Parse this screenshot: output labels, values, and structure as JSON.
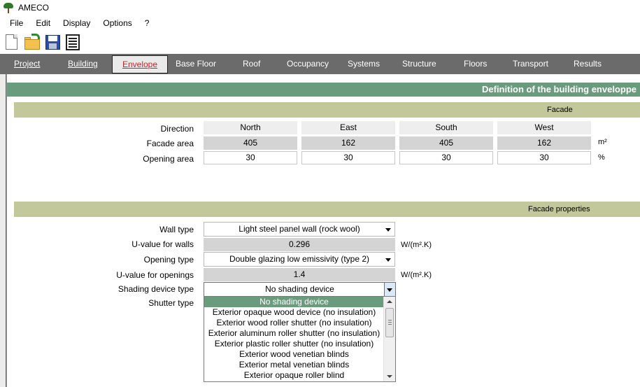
{
  "window": {
    "title": "AMECO"
  },
  "menu": [
    "File",
    "Edit",
    "Display",
    "Options",
    "?"
  ],
  "toolbar": {
    "icons": [
      "new-file-icon",
      "open-folder-icon",
      "save-disk-icon",
      "report-icon"
    ]
  },
  "tabs": [
    {
      "label": "Project"
    },
    {
      "label": "Building"
    },
    {
      "label": "Envelope"
    },
    {
      "label": "Base Floor"
    },
    {
      "label": "Roof"
    },
    {
      "label": "Occupancy"
    },
    {
      "label": "Systems"
    },
    {
      "label": "Structure"
    },
    {
      "label": "Floors"
    },
    {
      "label": "Transport"
    },
    {
      "label": "Results"
    }
  ],
  "page": {
    "header": "Definition of the building enveloppe"
  },
  "facade": {
    "section_title": "Facade",
    "direction_label": "Direction",
    "area_label": "Facade area",
    "opening_label": "Opening area",
    "area_unit": "m²",
    "opening_unit": "%",
    "columns": [
      {
        "direction": "North",
        "area": "405",
        "opening": "30"
      },
      {
        "direction": "East",
        "area": "162",
        "opening": "30"
      },
      {
        "direction": "South",
        "area": "405",
        "opening": "30"
      },
      {
        "direction": "West",
        "area": "162",
        "opening": "30"
      }
    ]
  },
  "properties": {
    "section_title": "Facade properties",
    "wall_type_label": "Wall type",
    "wall_type_value": "Light steel panel wall (rock wool)",
    "u_walls_label": "U-value for walls",
    "u_walls_value": "0.296",
    "u_unit": "W/(m².K)",
    "opening_type_label": "Opening type",
    "opening_type_value": "Double glazing low emissivity (type 2)",
    "u_openings_label": "U-value for openings",
    "u_openings_value": "1.4",
    "shading_label": "Shading device type",
    "shading_value": "No shading device",
    "shutter_label": "Shutter type"
  },
  "shading_options": [
    "No shading device",
    "Exterior opaque wood device (no insulation)",
    "Exterior wood roller shutter (no insulation)",
    "Exterior aluminum roller shutter (no insulation)",
    "Exterior plastic roller shutter (no insulation)",
    "Exterior wood venetian blinds",
    "Exterior metal venetian blinds",
    "Exterior opaque roller blind"
  ],
  "colors": {
    "nav_bg": "#6b6b6b",
    "header_green": "#6b9b7d",
    "section_olive": "#c2c89a",
    "active_tab_text": "#c0282c"
  }
}
